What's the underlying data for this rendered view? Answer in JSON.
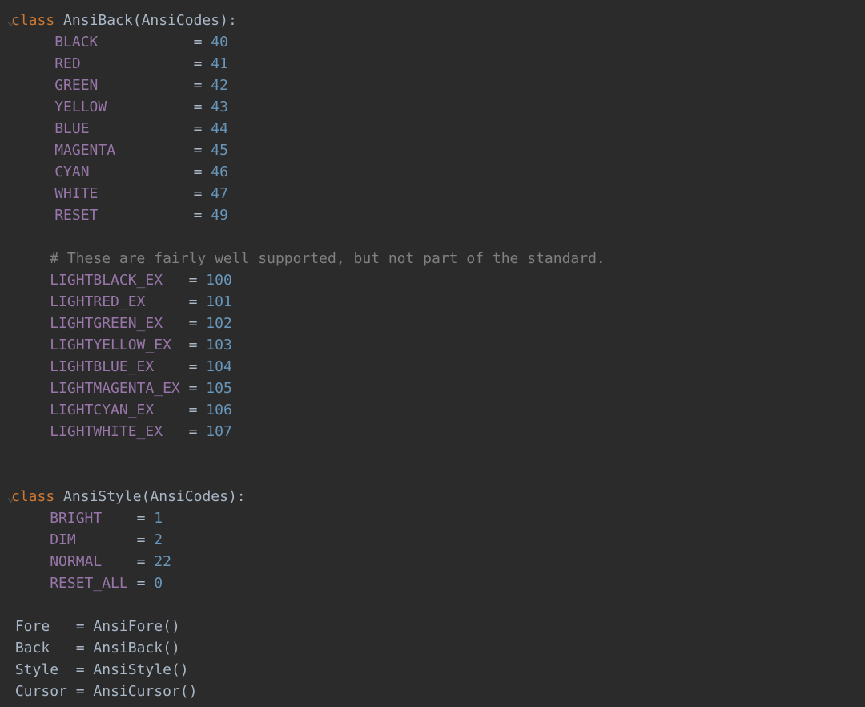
{
  "class1": {
    "keyword": "class",
    "name": "AnsiBack",
    "parent": "AnsiCodes",
    "attrs": [
      {
        "name": "BLACK",
        "pad": "          ",
        "value": "40"
      },
      {
        "name": "RED",
        "pad": "            ",
        "value": "41"
      },
      {
        "name": "GREEN",
        "pad": "          ",
        "value": "42"
      },
      {
        "name": "YELLOW",
        "pad": "         ",
        "value": "43"
      },
      {
        "name": "BLUE",
        "pad": "           ",
        "value": "44"
      },
      {
        "name": "MAGENTA",
        "pad": "        ",
        "value": "45"
      },
      {
        "name": "CYAN",
        "pad": "           ",
        "value": "46"
      },
      {
        "name": "WHITE",
        "pad": "          ",
        "value": "47"
      },
      {
        "name": "RESET",
        "pad": "          ",
        "value": "49"
      }
    ],
    "comment": "# These are fairly well supported, but not part of the standard.",
    "attrs2": [
      {
        "name": "LIGHTBLACK_EX",
        "pad": "  ",
        "value": "100"
      },
      {
        "name": "LIGHTRED_EX",
        "pad": "    ",
        "value": "101"
      },
      {
        "name": "LIGHTGREEN_EX",
        "pad": "  ",
        "value": "102"
      },
      {
        "name": "LIGHTYELLOW_EX",
        "pad": " ",
        "value": "103"
      },
      {
        "name": "LIGHTBLUE_EX",
        "pad": "   ",
        "value": "104"
      },
      {
        "name": "LIGHTMAGENTA_EX",
        "pad": "",
        "value": "105"
      },
      {
        "name": "LIGHTCYAN_EX",
        "pad": "   ",
        "value": "106"
      },
      {
        "name": "LIGHTWHITE_EX",
        "pad": "  ",
        "value": "107"
      }
    ]
  },
  "class2": {
    "keyword": "class",
    "name": "AnsiStyle",
    "parent": "AnsiCodes",
    "attrs": [
      {
        "name": "BRIGHT",
        "pad": "   ",
        "value": "1"
      },
      {
        "name": "DIM",
        "pad": "      ",
        "value": "2"
      },
      {
        "name": "NORMAL",
        "pad": "   ",
        "value": "22"
      },
      {
        "name": "RESET_ALL",
        "pad": "",
        "value": "0"
      }
    ]
  },
  "assignments": [
    {
      "lhs": "Fore",
      "pad": "  ",
      "rhs": "AnsiFore"
    },
    {
      "lhs": "Back",
      "pad": "  ",
      "rhs": "AnsiBack"
    },
    {
      "lhs": "Style",
      "pad": " ",
      "rhs": "AnsiStyle"
    },
    {
      "lhs": "Cursor",
      "pad": "",
      "rhs": "AnsiCursor"
    }
  ]
}
